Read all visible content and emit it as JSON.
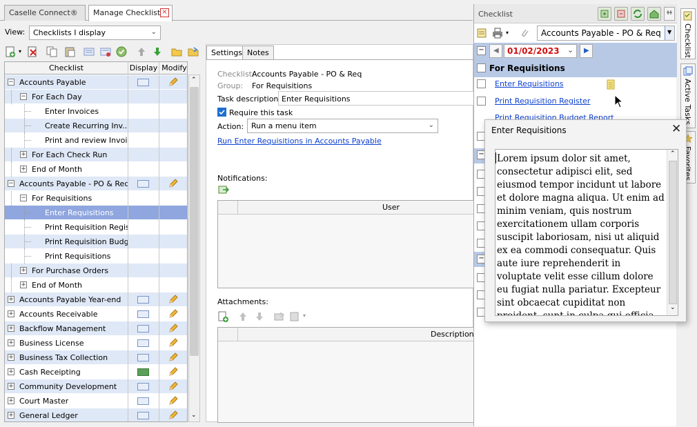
{
  "tabs": {
    "tab1": "Caselle Connect®",
    "tab2": "Manage Checklists"
  },
  "view": {
    "label": "View:",
    "value": "Checklists I display"
  },
  "grid": {
    "headers": {
      "checklist": "Checklist",
      "display": "Display",
      "modify": "Modify"
    },
    "rows": [
      {
        "label": "Accounts Payable"
      },
      {
        "label": "For Each Day"
      },
      {
        "label": "Enter Invoices"
      },
      {
        "label": "Create Recurring Inv..."
      },
      {
        "label": "Print and review Invoi..."
      },
      {
        "label": "For Each Check Run"
      },
      {
        "label": "End of Month"
      },
      {
        "label": "Accounts Payable - PO & Req"
      },
      {
        "label": "For Requisitions"
      },
      {
        "label": "Enter Requisitions"
      },
      {
        "label": "Print Requisition Regis..."
      },
      {
        "label": "Print Requisition Budg..."
      },
      {
        "label": "Print Requisitions"
      },
      {
        "label": "For Purchase Orders"
      },
      {
        "label": "End of Month"
      },
      {
        "label": "Accounts Payable Year-end"
      },
      {
        "label": "Accounts Receivable"
      },
      {
        "label": "Backflow Management"
      },
      {
        "label": "Business License"
      },
      {
        "label": "Business Tax Collection"
      },
      {
        "label": "Cash Receipting"
      },
      {
        "label": "Community Development"
      },
      {
        "label": "Court Master"
      },
      {
        "label": "General Ledger"
      }
    ]
  },
  "settings": {
    "tab_settings": "Settings",
    "tab_notes": "Notes",
    "checklist_label": "Checklist:",
    "checklist_value": "Accounts Payable - PO & Req",
    "group_label": "Group:",
    "group_value": "For Requisitions",
    "task_desc_label": "Task description:",
    "task_desc_value": "Enter Requisitions",
    "require_label": "Require this task",
    "action_label": "Action:",
    "action_value": "Run a menu item",
    "run_link": "Run Enter Requisitions in Accounts Payable",
    "notifications_label": "Notifications:",
    "user_header": "User",
    "attachments_label": "Attachments:",
    "description_header": "Description"
  },
  "checklist_panel": {
    "title": "Checklist",
    "checklist_select": "Accounts Payable - PO & Req",
    "date": "01/02/2023",
    "group_title": "For Requisitions",
    "items": [
      "Enter Requisitions",
      "Print Requisition Register",
      "Print Requisition Budget Report"
    ]
  },
  "side_tabs": {
    "checklist": "Checklist",
    "active_tasks": "Active Tasks",
    "favorites": "Favorites"
  },
  "popup": {
    "title": "Enter Requisitions",
    "body": "Lorem ipsum dolor sit amet, consectetur adipisci elit, sed eiusmod tempor incidunt ut labore et dolore magna aliqua. Ut enim ad minim veniam, quis nostrum exercitationem ullam corporis suscipit laboriosam, nisi ut aliquid ex ea commodi consequatur. Quis aute iure reprehenderit in voluptate velit esse cillum dolore eu fugiat nulla pariatur. Excepteur sint obcaecat cupiditat non proident, sunt in culpa qui officia deserunt mollit anim id est laborum."
  },
  "colors": {
    "accent": "#1e6fd0",
    "selection": "#8fa6df",
    "alt_row": "#dfe8f6",
    "date_red": "#d01010",
    "panel_blue": "#b8c9e6"
  },
  "icons": [
    "new-icon",
    "delete-icon",
    "copy-icon",
    "paste-icon",
    "display-icon",
    "modify-icon",
    "check-icon",
    "up-arrow-icon",
    "down-arrow-icon",
    "folder-icon",
    "print-icon",
    "pencil-icon",
    "refresh-icon",
    "home-icon",
    "note-icon",
    "close-icon"
  ]
}
